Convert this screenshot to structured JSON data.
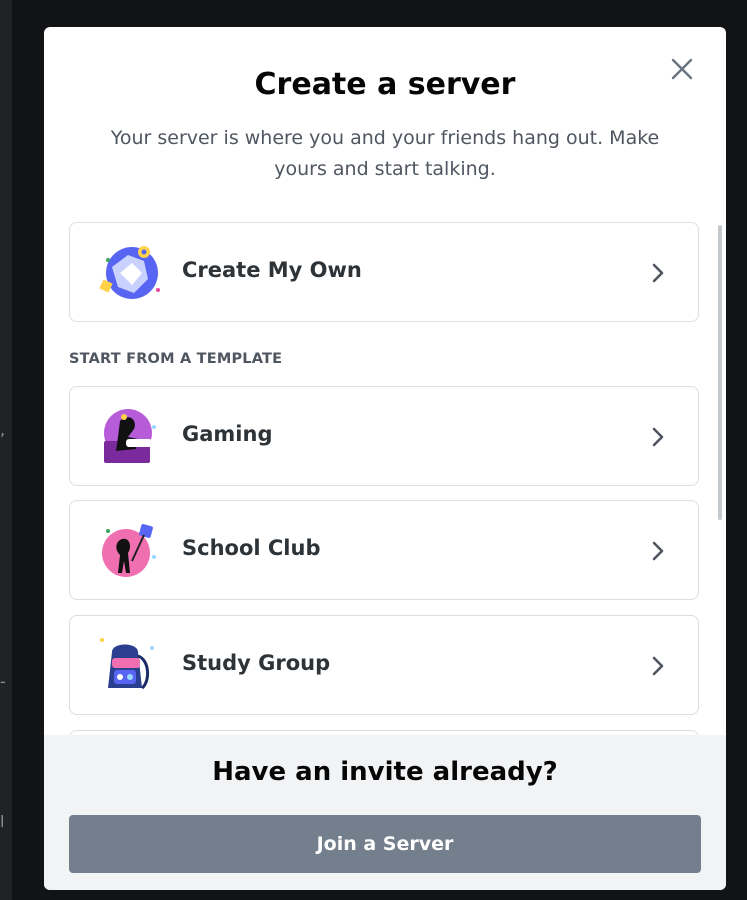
{
  "background": {
    "fragments": [
      ",",
      "-",
      "l"
    ]
  },
  "modal": {
    "title": "Create a server",
    "subtitle": "Your server is where you and your friends hang out. Make yours and start talking.",
    "close_icon": "close-icon",
    "primary_option": {
      "label": "Create My Own",
      "icon": "globe-illustration"
    },
    "section_label": "START FROM A TEMPLATE",
    "templates": [
      {
        "label": "Gaming",
        "icon": "gaming-illustration"
      },
      {
        "label": "School Club",
        "icon": "school-club-illustration"
      },
      {
        "label": "Study Group",
        "icon": "backpack-illustration"
      }
    ],
    "footer": {
      "prompt": "Have an invite already?",
      "button_label": "Join a Server"
    }
  },
  "colors": {
    "button_grey": "#747f8d",
    "title_text": "#060607",
    "muted_text": "#4f5660",
    "option_border": "#dcdde0",
    "footer_bg": "#f2f3f5"
  }
}
